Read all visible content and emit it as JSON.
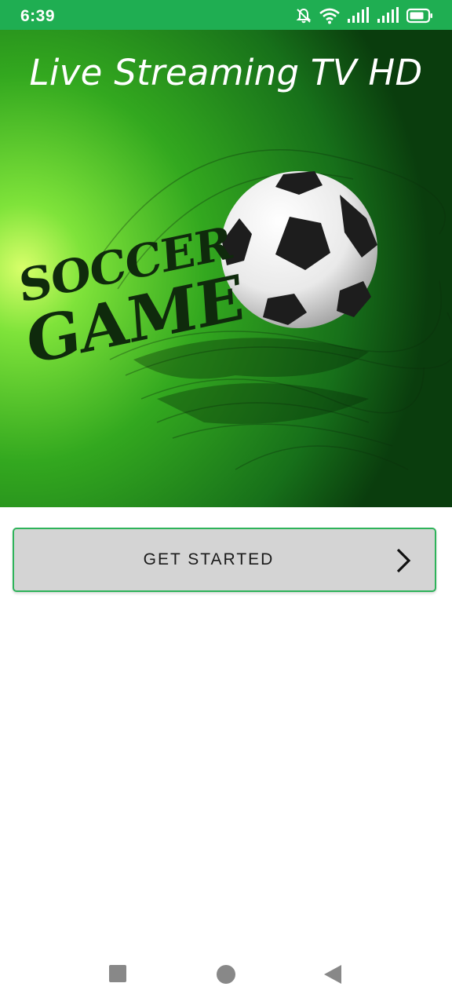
{
  "status_bar": {
    "time": "6:39",
    "icons": [
      "bell-off-icon",
      "wifi-icon",
      "signal-icon",
      "signal-icon",
      "battery-icon"
    ]
  },
  "hero": {
    "title": "Live Streaming TV HD",
    "art_text_line1": "SOCCER",
    "art_text_line2": "GAME"
  },
  "get_started": {
    "label": "GET STARTED",
    "icon": "chevron-right-icon"
  },
  "nav": {
    "buttons": [
      "recents-square-icon",
      "home-circle-icon",
      "back-triangle-icon"
    ]
  },
  "colors": {
    "status_bar": "#1fae52",
    "button_border": "#2eb35a",
    "button_bg": "#d4d4d4"
  }
}
